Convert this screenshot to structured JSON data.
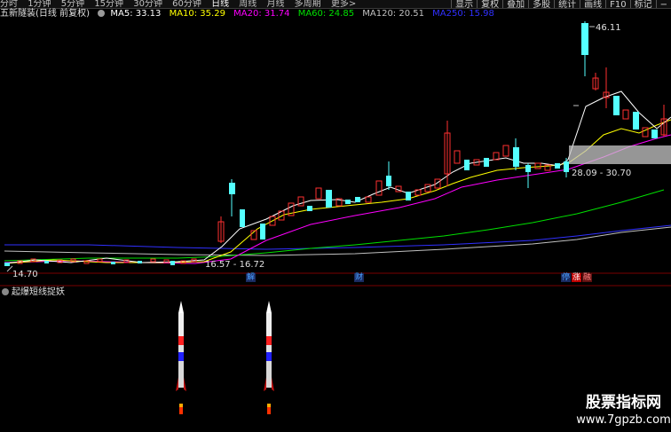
{
  "toolbar": {
    "periods": [
      "分时",
      "1分钟",
      "5分钟",
      "15分钟",
      "30分钟",
      "60分钟",
      "日线",
      "周线",
      "月线",
      "多周期",
      "更多>"
    ],
    "active_period": "日线",
    "right_buttons": [
      "显示",
      "复权",
      "叠加",
      "多股",
      "统计",
      "画线",
      "F10",
      "标记",
      "−"
    ]
  },
  "legend": {
    "title": "五新隧装(日线 前复权)",
    "ma": [
      {
        "label": "MA5: 33.13",
        "color": "#ffffff"
      },
      {
        "label": "MA10: 35.29",
        "color": "#ffff00"
      },
      {
        "label": "MA20: 31.74",
        "color": "#ff00ff"
      },
      {
        "label": "MA60: 24.85",
        "color": "#00e000"
      },
      {
        "label": "MA120: 20.51",
        "color": "#c0c0c0"
      },
      {
        "label": "MA250: 15.98",
        "color": "#3030ff"
      }
    ]
  },
  "annotations": {
    "high": "46.11",
    "low": "14.70",
    "range1": "16.57 - 16.72",
    "range2": "28.09 - 30.70"
  },
  "badges": [
    {
      "text": "解",
      "color": "#4aa0ff",
      "bg": "#1a2a60"
    },
    {
      "text": "财",
      "color": "#4aa0ff",
      "bg": "#1a2a60"
    },
    {
      "text": "停",
      "color": "#4aa0ff",
      "bg": "#1a2a60"
    },
    {
      "text": "涨",
      "color": "#ffffff",
      "bg": "#c00000"
    },
    {
      "text": "融",
      "color": "#ff8080",
      "bg": "#601010"
    }
  ],
  "indicator": {
    "title": "起爆短线捉妖"
  },
  "watermark": {
    "line1": "股票指标网",
    "line2": "www.7gpzb.com"
  },
  "colors": {
    "up": "#ff3030",
    "down": "#54ffff",
    "ma5": "#ffffff",
    "ma10": "#ffff00",
    "ma20": "#ff00ff",
    "ma60": "#00e000",
    "ma120": "#c0c0c0",
    "ma250": "#3030ff"
  }
}
